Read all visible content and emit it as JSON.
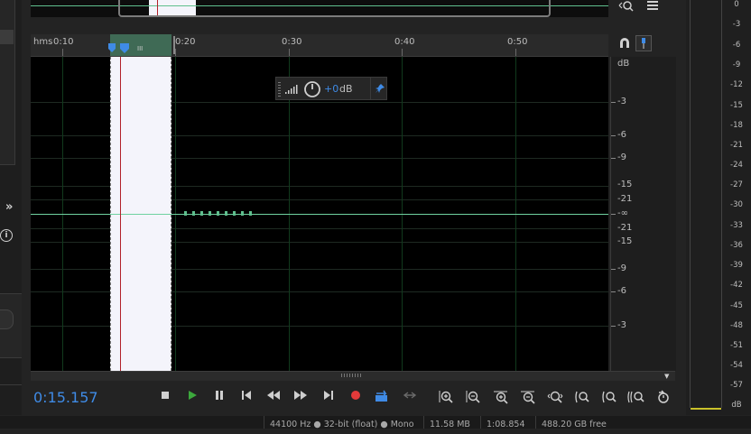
{
  "ruler": {
    "prefix": "hms",
    "labels": [
      "0:10",
      "0:20",
      "0:30",
      "0:40",
      "0:50"
    ],
    "selection_marker": "III"
  },
  "hud": {
    "gain": "+0",
    "unit": "dB"
  },
  "db_scale": {
    "header": "dB",
    "labels": [
      "-3",
      "-6",
      "-9",
      "-15",
      "-21",
      "-∞",
      "-21",
      "-15",
      "-9",
      "-6",
      "-3"
    ]
  },
  "meter": {
    "labels": [
      "0",
      "-3",
      "-6",
      "-9",
      "-12",
      "-15",
      "-18",
      "-21",
      "-24",
      "-27",
      "-30",
      "-33",
      "-36",
      "-39",
      "-42",
      "-45",
      "-48",
      "-51",
      "-54",
      "-57",
      "dB"
    ]
  },
  "transport": {
    "time": "0:15.157"
  },
  "status": {
    "format": "44100 Hz ● 32-bit (float) ● Mono",
    "size": "11.58 MB",
    "duration": "1:08.854",
    "free": "488.20 GB free"
  },
  "icons": {
    "stop": "stop-icon",
    "play": "play-icon",
    "pause": "pause-icon",
    "record": "record-icon",
    "zoom": "zoom-icon"
  },
  "colors": {
    "accent": "#3f8be6",
    "playhead": "#b2222a",
    "waveform": "#6fd2a0",
    "record": "#e33a3a",
    "play": "#3ca83c",
    "meter_peak": "#c9c12a"
  }
}
